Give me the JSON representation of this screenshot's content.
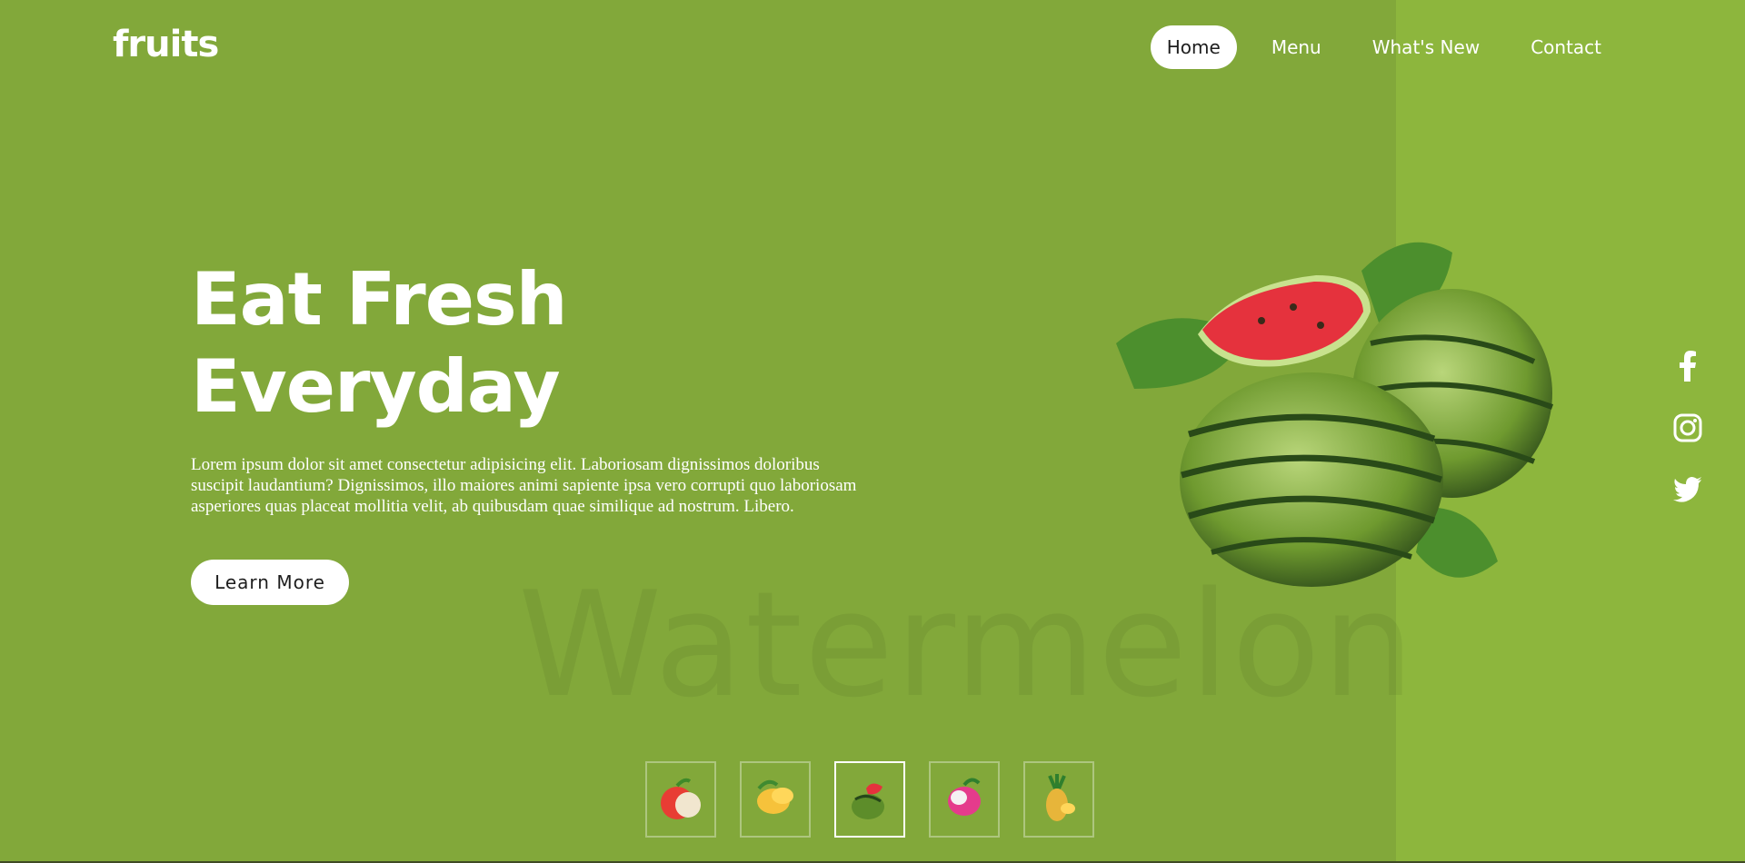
{
  "app": {
    "logo": "fruits"
  },
  "nav": {
    "items": [
      {
        "label": "Home",
        "active": true
      },
      {
        "label": "Menu",
        "active": false
      },
      {
        "label": "What's New",
        "active": false
      },
      {
        "label": "Contact",
        "active": false
      }
    ]
  },
  "hero": {
    "title_line1": "Eat Fresh",
    "title_line2": "Everyday",
    "description": "Lorem ipsum dolor sit amet consectetur adipisicing elit. Laboriosam dignissimos doloribus suscipit laudantium? Dignissimos, illo maiores animi sapiente ipsa vero corrupti quo laboriosam asperiores quas placeat mollitia velit, ab quibusdam quae similique ad nostrum. Libero.",
    "cta_label": "Learn More",
    "watermark": "Watermelon",
    "featured_fruit_icon": "watermelon-icon"
  },
  "social": [
    {
      "icon": "facebook-icon"
    },
    {
      "icon": "instagram-icon"
    },
    {
      "icon": "twitter-icon"
    }
  ],
  "thumbnails": [
    {
      "icon": "apple-icon",
      "active": false
    },
    {
      "icon": "mango-icon",
      "active": false
    },
    {
      "icon": "watermelon-icon",
      "active": true
    },
    {
      "icon": "dragonfruit-icon",
      "active": false
    },
    {
      "icon": "pineapple-icon",
      "active": false
    }
  ],
  "colors": {
    "background": "#82a83a",
    "right_panel": "#8db63d",
    "text": "#ffffff",
    "active_nav_text": "#1d1d1d"
  }
}
